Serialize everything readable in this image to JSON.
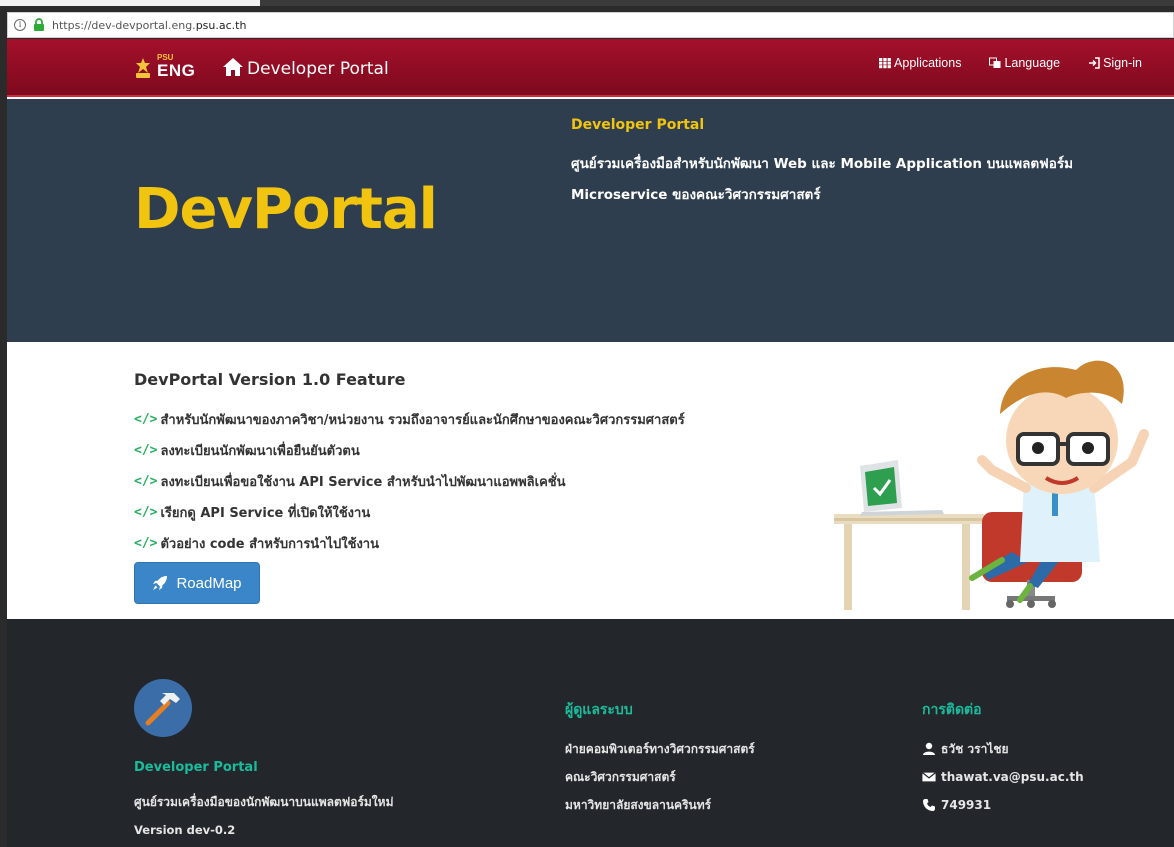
{
  "browser": {
    "url_prefix": "https://dev-devportal.eng.",
    "url_domain": "psu.ac.th"
  },
  "navbar": {
    "logo_small": "PSU",
    "logo_big": "ENG",
    "title": "Developer Portal",
    "links": {
      "applications": "Applications",
      "language": "Language",
      "signin": "Sign-in"
    }
  },
  "hero": {
    "title": "DevPortal",
    "subtitle": "Developer Portal",
    "description": "ศูนย์รวมเครื่องมือสำหรับนักพัฒนา Web และ Mobile Application บนแพลตฟอร์ม Microservice ของคณะวิศวกรรมศาสตร์"
  },
  "features": {
    "title": "DevPortal Version 1.0 Feature",
    "code_glyph": "</>",
    "items": [
      "สำหรับนักพัฒนาของภาควิชา/หน่วยงาน รวมถึงอาจารย์และนักศึกษาของคณะวิศวกรรมศาสตร์",
      "ลงทะเบียนนักพัฒนาเพื่อยืนยันตัวตน",
      "ลงทะเบียนเพื่อขอใช้งาน API Service สำหรับนำไปพัฒนาแอพพลิเคชั่น",
      "เรียกดู API Service ที่เปิดให้ใช้งาน",
      "ตัวอย่าง code สำหรับการนำไปใช้งาน"
    ],
    "roadmap_label": "RoadMap"
  },
  "footer": {
    "col1": {
      "title": "Developer Portal",
      "description": "ศูนย์รวมเครื่องมือของนักพัฒนาบนแพลตฟอร์มใหม่",
      "version": "Version dev-0.2"
    },
    "col2": {
      "title": "ผู้ดูแลระบบ",
      "lines": [
        "ฝ่ายคอมพิวเตอร์ทางวิศวกรรมศาสตร์",
        "คณะวิศวกรรมศาสตร์",
        "มหาวิทยาลัยสงขลานครินทร์"
      ]
    },
    "col3": {
      "title": "การติดต่อ",
      "name": "ธวัช วราไชย",
      "email": "thawat.va@psu.ac.th",
      "phone": "749931"
    }
  },
  "colors": {
    "navbar": "#9a0e27",
    "hero_bg": "#2f3e4f",
    "accent_yellow": "#f1c40f",
    "accent_green": "#1abc9c",
    "button_blue": "#3a86c8",
    "footer_bg": "#23272b"
  },
  "icons": {
    "home": "home-icon",
    "applications": "grid-icon",
    "language": "language-icon",
    "signin": "signin-icon",
    "roadmap": "rocket-icon",
    "user": "user-icon",
    "email": "envelope-icon",
    "phone": "phone-icon"
  }
}
